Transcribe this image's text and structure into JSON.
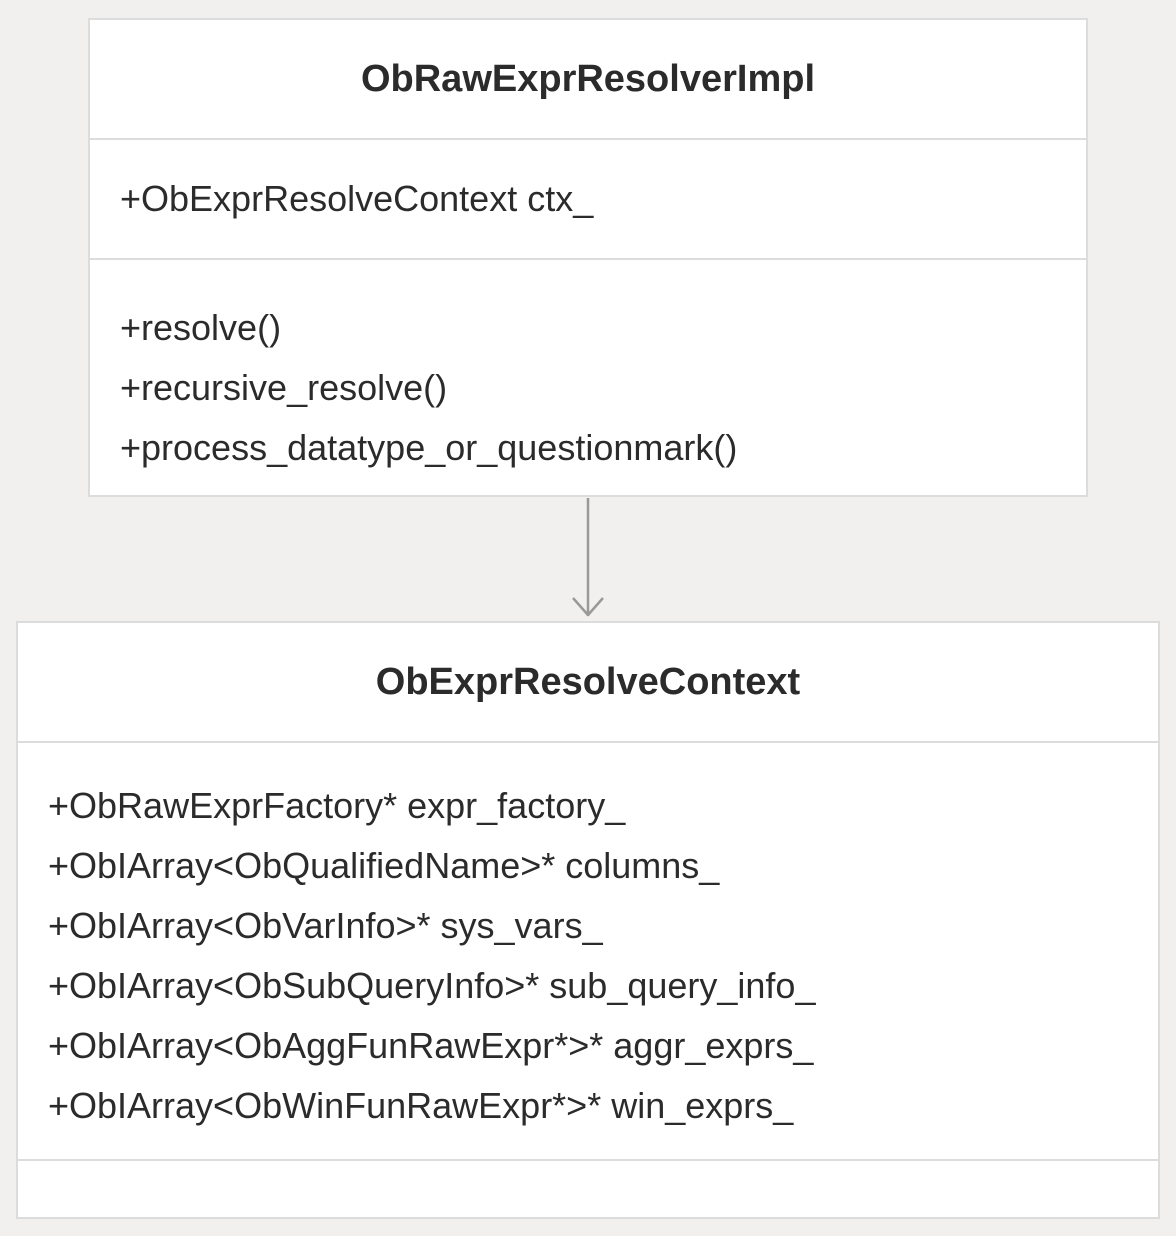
{
  "classes": [
    {
      "name": "ObRawExprResolverImpl",
      "attributes": [
        "+ObExprResolveContext ctx_"
      ],
      "methods": [
        "+resolve()",
        "+recursive_resolve()",
        "+process_datatype_or_questionmark()"
      ]
    },
    {
      "name": "ObExprResolveContext",
      "attributes": [
        "+ObRawExprFactory* expr_factory_",
        "+ObIArray<ObQualifiedName>* columns_",
        "+ObIArray<ObVarInfo>* sys_vars_",
        "+ObIArray<ObSubQueryInfo>* sub_query_info_",
        "+ObIArray<ObAggFunRawExpr*>* aggr_exprs_",
        "+ObIArray<ObWinFunRawExpr*>* win_exprs_"
      ],
      "methods": []
    }
  ],
  "relations": [
    {
      "from": "ObRawExprResolverImpl",
      "to": "ObExprResolveContext",
      "type": "association"
    }
  ],
  "colors": {
    "background": "#f1f0ef",
    "box_fill": "#ffffff",
    "box_border": "#dcdcdc",
    "text": "#2b2b2b",
    "arrow": "#999999"
  }
}
